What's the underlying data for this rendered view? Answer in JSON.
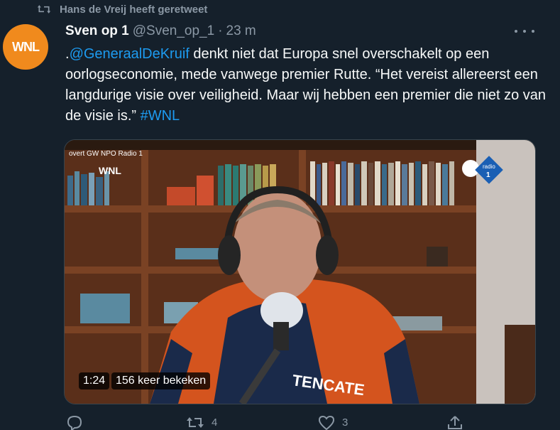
{
  "retweet": {
    "text": "Hans de Vreij heeft geretweet",
    "icon": "retweet-icon"
  },
  "author": {
    "avatar_text": "WNL",
    "name": "Sven op 1",
    "handle": "@Sven_op_1",
    "separator": "·",
    "time": "23 m"
  },
  "tweet": {
    "prefix": ".",
    "mention": "@GeneraalDeKruif",
    "body": " denkt niet dat Europa snel overschakelt op een oorlogseconomie, mede vanwege premier Rutte. “Het vereist allereerst een langdurige visie over veiligheid. Maar wij hebben een premier die niet zo van de visie is.” ",
    "hashtag": "#WNL"
  },
  "media": {
    "duration": "1:24",
    "views": "156 keer bekeken",
    "logo_left": "WNL",
    "stream_title": "overt GW NPO Radio 1",
    "shirt_text": "TENCATE",
    "logo_right": "radio",
    "logo_right_num": "1"
  },
  "actions": {
    "reply_count": "",
    "retweet_count": "4",
    "like_count": "3"
  },
  "colors": {
    "background": "#15202b",
    "accent": "#1d9bf0",
    "muted": "#8b98a5",
    "avatar": "#f08a1d"
  }
}
